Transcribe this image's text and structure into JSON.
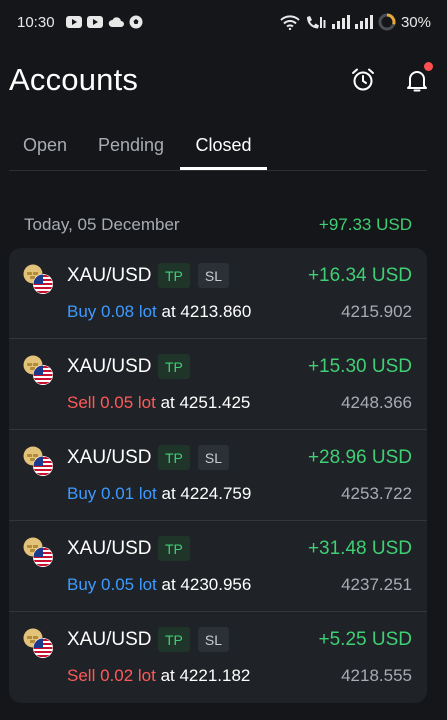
{
  "status_bar": {
    "time": "10:30",
    "battery": "30%"
  },
  "header": {
    "title": "Accounts",
    "icons": [
      "alarm-clock-icon",
      "bell-icon"
    ]
  },
  "tabs": [
    {
      "label": "Open",
      "active": false
    },
    {
      "label": "Pending",
      "active": false
    },
    {
      "label": "Closed",
      "active": true
    }
  ],
  "day_group": {
    "label": "Today, 05 December",
    "total": "+97.33 USD"
  },
  "deals": [
    {
      "symbol": "XAU/USD",
      "tp": "TP",
      "sl": "SL",
      "profit": "+16.34 USD",
      "side": "Buy 0.08 lot",
      "side_type": "buy",
      "at_label": " at ",
      "open_price": "4213.860",
      "close_price": "4215.902"
    },
    {
      "symbol": "XAU/USD",
      "tp": "TP",
      "sl": "",
      "profit": "+15.30 USD",
      "side": "Sell 0.05 lot",
      "side_type": "sell",
      "at_label": " at ",
      "open_price": "4251.425",
      "close_price": "4248.366"
    },
    {
      "symbol": "XAU/USD",
      "tp": "TP",
      "sl": "SL",
      "profit": "+28.96 USD",
      "side": "Buy 0.01 lot",
      "side_type": "buy",
      "at_label": " at ",
      "open_price": "4224.759",
      "close_price": "4253.722"
    },
    {
      "symbol": "XAU/USD",
      "tp": "TP",
      "sl": "",
      "profit": "+31.48 USD",
      "side": "Buy 0.05 lot",
      "side_type": "buy",
      "at_label": " at ",
      "open_price": "4230.956",
      "close_price": "4237.251"
    },
    {
      "symbol": "XAU/USD",
      "tp": "TP",
      "sl": "SL",
      "profit": "+5.25 USD",
      "side": "Sell 0.02 lot",
      "side_type": "sell",
      "at_label": " at ",
      "open_price": "4221.182",
      "close_price": "4218.555"
    }
  ],
  "colors": {
    "background": "#141619",
    "card": "#1f2226",
    "profit_green": "#3fcf74",
    "buy_blue": "#3d9bff",
    "sell_red": "#ff5a5a",
    "muted": "#a8acb2"
  }
}
